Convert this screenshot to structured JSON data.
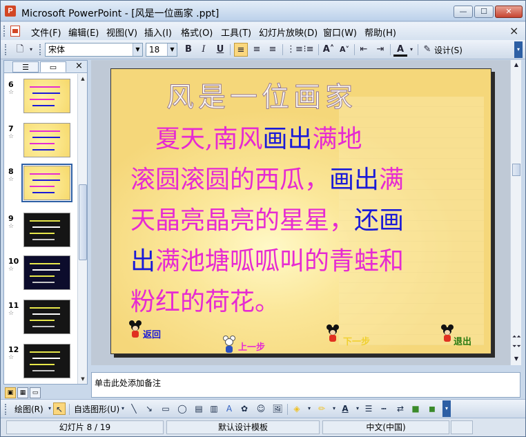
{
  "window": {
    "title": "Microsoft PowerPoint - [风是一位画家 .ppt]",
    "app_icon_letter": "P",
    "minimize": "—",
    "maximize": "☐",
    "close": "✕"
  },
  "menu": {
    "items": [
      "文件(F)",
      "编辑(E)",
      "视图(V)",
      "插入(I)",
      "格式(O)",
      "工具(T)",
      "幻灯片放映(D)",
      "窗口(W)",
      "帮助(H)"
    ],
    "close_doc": "×"
  },
  "format_toolbar": {
    "font_name": "宋体",
    "font_size": "18",
    "bold": "B",
    "italic": "I",
    "underline": "U",
    "design_label": "设计(S)"
  },
  "outline_pane": {
    "tab_outline_icon": "outline-icon",
    "tab_slides_icon": "slides-icon",
    "close": "×",
    "slides": [
      {
        "number": "6",
        "theme": "yellow"
      },
      {
        "number": "7",
        "theme": "yellow"
      },
      {
        "number": "8",
        "theme": "yellow",
        "selected": true
      },
      {
        "number": "9",
        "theme": "dark"
      },
      {
        "number": "10",
        "theme": "navy"
      },
      {
        "number": "11",
        "theme": "dark"
      },
      {
        "number": "12",
        "theme": "dark"
      }
    ]
  },
  "slide": {
    "title": "风是一位画家",
    "body_lines": [
      [
        {
          "t": "　夏天,南风",
          "c": "pink"
        },
        {
          "t": "画出",
          "c": "blue"
        },
        {
          "t": "满地",
          "c": "pink"
        }
      ],
      [
        {
          "t": "滚圆滚圆的西瓜，",
          "c": "pink"
        },
        {
          "t": "画出",
          "c": "blue"
        },
        {
          "t": "满",
          "c": "pink"
        }
      ],
      [
        {
          "t": "天晶亮晶亮的星星，",
          "c": "pink"
        },
        {
          "t": "还画",
          "c": "blue"
        }
      ],
      [
        {
          "t": "出",
          "c": "blue"
        },
        {
          "t": "满池塘呱呱叫的青蛙和",
          "c": "pink"
        }
      ],
      [
        {
          "t": "粉红的荷花。",
          "c": "pink"
        }
      ]
    ],
    "nav": {
      "back": "返回",
      "prev": "上一步",
      "next": "下一步",
      "exit": "退出"
    }
  },
  "notes": {
    "placeholder": "单击此处添加备注"
  },
  "draw_toolbar": {
    "draw_label": "绘图(R)",
    "autoshapes_label": "自选图形(U)"
  },
  "status": {
    "slide_position": "幻灯片 8 / 19",
    "design_template": "默认设计模板",
    "language": "中文(中国)"
  },
  "colors": {
    "pink_text": "#e62ad2",
    "blue_text": "#1a1ad8",
    "accent": "#2d5fa4"
  }
}
